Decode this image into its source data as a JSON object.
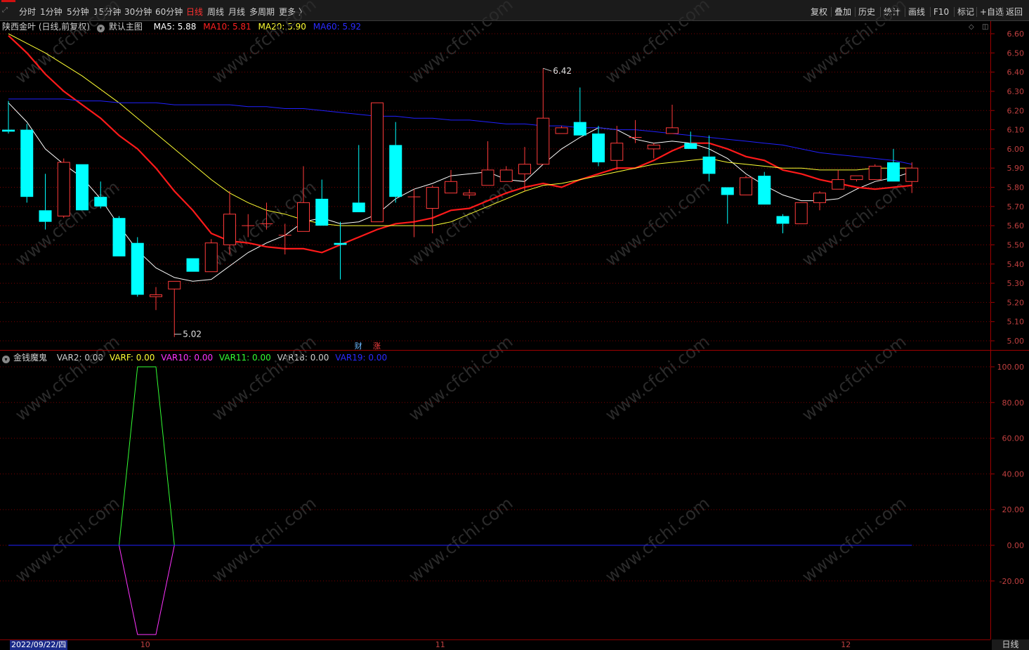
{
  "toolbar": {
    "periods": [
      "分时",
      "1分钟",
      "5分钟",
      "15分钟",
      "30分钟",
      "60分钟",
      "日线",
      "周线",
      "月线",
      "多周期",
      "更多 〉"
    ],
    "active_period": "日线",
    "tools": [
      "复权",
      "叠加",
      "历史",
      "统计",
      "画线",
      "F10",
      "标记",
      "+自选",
      "返回"
    ]
  },
  "main_legend": {
    "stock": "陕西金叶 (日线,前复权)",
    "template": "默认主图",
    "ma5": "MA5: 5.88",
    "ma10": "MA10: 5.81",
    "ma20": "MA20: 5.90",
    "ma60": "MA60: 5.92"
  },
  "sub_legend": {
    "name": "金钱魔鬼",
    "var2": "VAR2: 0.00",
    "varf": "VARF: 0.00",
    "var10": "VAR10: 0.00",
    "var11": "VAR11: 0.00",
    "var18": "VAR18: 0.00",
    "var19": "VAR19: 0.00"
  },
  "markers": {
    "cai": "财",
    "zhang": "涨"
  },
  "annotations": {
    "high": "6.42",
    "low": "5.02"
  },
  "date_axis": {
    "first_date": "2022/09/22/四",
    "month_ticks": [
      "10",
      "11",
      "12"
    ],
    "period_label": "日线"
  },
  "watermark": "www.cfchi.com",
  "colors": {
    "up": "#ff3a3a",
    "down": "#00ffff",
    "ma5": "#ffffff",
    "ma10": "#ff1a1a",
    "ma20": "#ffff33",
    "ma60": "#2020ff",
    "grid": "#7a0000",
    "axis": "#a00000",
    "var_green": "#33ff33",
    "var_magenta": "#ff33ff",
    "zero_line": "#2020ff"
  },
  "chart_data": [
    {
      "type": "candlestick",
      "title": "陕西金叶 (日线,前复权)",
      "ylim": [
        5.0,
        6.6
      ],
      "y_ticks": [
        5.0,
        5.1,
        5.2,
        5.3,
        5.4,
        5.5,
        5.6,
        5.7,
        5.8,
        5.9,
        6.0,
        6.1,
        6.2,
        6.3,
        6.4,
        6.5,
        6.6
      ],
      "candles": [
        {
          "o": 6.1,
          "h": 6.25,
          "l": 6.08,
          "c": 6.09
        },
        {
          "o": 6.1,
          "h": 6.13,
          "l": 5.72,
          "c": 5.75
        },
        {
          "o": 5.68,
          "h": 5.87,
          "l": 5.58,
          "c": 5.62
        },
        {
          "o": 5.65,
          "h": 5.95,
          "l": 5.64,
          "c": 5.93
        },
        {
          "o": 5.92,
          "h": 5.92,
          "l": 5.68,
          "c": 5.68
        },
        {
          "o": 5.75,
          "h": 5.83,
          "l": 5.69,
          "c": 5.7
        },
        {
          "o": 5.64,
          "h": 5.65,
          "l": 5.44,
          "c": 5.44
        },
        {
          "o": 5.51,
          "h": 5.54,
          "l": 5.23,
          "c": 5.24
        },
        {
          "o": 5.23,
          "h": 5.28,
          "l": 5.16,
          "c": 5.24
        },
        {
          "o": 5.27,
          "h": 5.31,
          "l": 5.02,
          "c": 5.31
        },
        {
          "o": 5.43,
          "h": 5.43,
          "l": 5.36,
          "c": 5.36
        },
        {
          "o": 5.36,
          "h": 5.53,
          "l": 5.36,
          "c": 5.51
        },
        {
          "o": 5.5,
          "h": 5.78,
          "l": 5.45,
          "c": 5.66
        },
        {
          "o": 5.6,
          "h": 5.66,
          "l": 5.54,
          "c": 5.6
        },
        {
          "o": 5.61,
          "h": 5.72,
          "l": 5.58,
          "c": 5.61
        },
        {
          "o": 5.55,
          "h": 5.61,
          "l": 5.45,
          "c": 5.55
        },
        {
          "o": 5.57,
          "h": 5.91,
          "l": 5.57,
          "c": 5.72
        },
        {
          "o": 5.74,
          "h": 5.84,
          "l": 5.6,
          "c": 5.6
        },
        {
          "o": 5.51,
          "h": 5.62,
          "l": 5.32,
          "c": 5.5
        },
        {
          "o": 5.72,
          "h": 6.02,
          "l": 5.71,
          "c": 5.67
        },
        {
          "o": 5.62,
          "h": 6.24,
          "l": 5.62,
          "c": 6.24
        },
        {
          "o": 6.02,
          "h": 6.14,
          "l": 5.72,
          "c": 5.75
        },
        {
          "o": 5.75,
          "h": 5.79,
          "l": 5.54,
          "c": 5.75
        },
        {
          "o": 5.69,
          "h": 5.81,
          "l": 5.56,
          "c": 5.8
        },
        {
          "o": 5.77,
          "h": 5.89,
          "l": 5.77,
          "c": 5.83
        },
        {
          "o": 5.76,
          "h": 5.79,
          "l": 5.74,
          "c": 5.77
        },
        {
          "o": 5.81,
          "h": 6.04,
          "l": 5.81,
          "c": 5.89
        },
        {
          "o": 5.83,
          "h": 5.91,
          "l": 5.83,
          "c": 5.89
        },
        {
          "o": 5.87,
          "h": 6.01,
          "l": 5.78,
          "c": 5.92
        },
        {
          "o": 5.92,
          "h": 6.42,
          "l": 5.92,
          "c": 6.16
        },
        {
          "o": 6.08,
          "h": 6.12,
          "l": 6.08,
          "c": 6.11
        },
        {
          "o": 6.14,
          "h": 6.32,
          "l": 6.07,
          "c": 6.07
        },
        {
          "o": 6.08,
          "h": 6.12,
          "l": 5.91,
          "c": 5.93
        },
        {
          "o": 5.94,
          "h": 6.12,
          "l": 5.89,
          "c": 6.03
        },
        {
          "o": 6.06,
          "h": 6.15,
          "l": 6.03,
          "c": 6.06
        },
        {
          "o": 6.0,
          "h": 6.03,
          "l": 5.95,
          "c": 6.02
        },
        {
          "o": 6.08,
          "h": 6.23,
          "l": 6.08,
          "c": 6.11
        },
        {
          "o": 6.03,
          "h": 6.09,
          "l": 6.0,
          "c": 6.0
        },
        {
          "o": 5.96,
          "h": 6.07,
          "l": 5.83,
          "c": 5.87
        },
        {
          "o": 5.8,
          "h": 5.8,
          "l": 5.61,
          "c": 5.76
        },
        {
          "o": 5.76,
          "h": 5.86,
          "l": 5.76,
          "c": 5.85
        },
        {
          "o": 5.86,
          "h": 5.88,
          "l": 5.71,
          "c": 5.71
        },
        {
          "o": 5.65,
          "h": 5.66,
          "l": 5.56,
          "c": 5.61
        },
        {
          "o": 5.61,
          "h": 5.72,
          "l": 5.61,
          "c": 5.72
        },
        {
          "o": 5.72,
          "h": 5.78,
          "l": 5.68,
          "c": 5.77
        },
        {
          "o": 5.79,
          "h": 5.89,
          "l": 5.79,
          "c": 5.84
        },
        {
          "o": 5.84,
          "h": 5.86,
          "l": 5.83,
          "c": 5.86
        },
        {
          "o": 5.84,
          "h": 5.92,
          "l": 5.84,
          "c": 5.91
        },
        {
          "o": 5.93,
          "h": 6.0,
          "l": 5.83,
          "c": 5.83
        },
        {
          "o": 5.83,
          "h": 5.93,
          "l": 5.77,
          "c": 5.9
        }
      ],
      "series": [
        {
          "name": "MA5",
          "values": [
            6.24,
            6.14,
            6.0,
            5.92,
            5.85,
            5.74,
            5.6,
            5.47,
            5.38,
            5.33,
            5.31,
            5.32,
            5.39,
            5.46,
            5.51,
            5.55,
            5.62,
            5.64,
            5.61,
            5.62,
            5.66,
            5.74,
            5.79,
            5.82,
            5.86,
            5.87,
            5.88,
            5.84,
            5.83,
            5.92,
            6.0,
            6.06,
            6.11,
            6.1,
            6.05,
            6.03,
            6.04,
            6.03,
            6.0,
            5.95,
            5.87,
            5.81,
            5.76,
            5.73,
            5.73,
            5.74,
            5.79,
            5.83,
            5.85,
            5.88
          ]
        },
        {
          "name": "MA10",
          "values": [
            6.59,
            6.5,
            6.39,
            6.3,
            6.23,
            6.16,
            6.07,
            6.0,
            5.9,
            5.78,
            5.68,
            5.56,
            5.52,
            5.51,
            5.49,
            5.48,
            5.48,
            5.46,
            5.5,
            5.54,
            5.58,
            5.61,
            5.62,
            5.64,
            5.68,
            5.69,
            5.73,
            5.77,
            5.8,
            5.82,
            5.8,
            5.84,
            5.87,
            5.9,
            5.9,
            5.94,
            5.99,
            6.03,
            6.03,
            6.0,
            5.96,
            5.94,
            5.89,
            5.87,
            5.84,
            5.82,
            5.8,
            5.79,
            5.8,
            5.81
          ]
        },
        {
          "name": "MA20",
          "values": [
            6.6,
            6.55,
            6.5,
            6.44,
            6.38,
            6.31,
            6.24,
            6.16,
            6.08,
            6.0,
            5.92,
            5.84,
            5.77,
            5.72,
            5.68,
            5.66,
            5.63,
            5.61,
            5.6,
            5.6,
            5.6,
            5.6,
            5.6,
            5.6,
            5.62,
            5.66,
            5.7,
            5.74,
            5.78,
            5.81,
            5.82,
            5.84,
            5.86,
            5.88,
            5.9,
            5.92,
            5.93,
            5.94,
            5.95,
            5.93,
            5.92,
            5.91,
            5.9,
            5.9,
            5.89,
            5.89,
            5.89,
            5.9,
            5.9,
            5.9
          ]
        },
        {
          "name": "MA60",
          "values": [
            6.26,
            6.26,
            6.26,
            6.26,
            6.25,
            6.25,
            6.24,
            6.24,
            6.24,
            6.23,
            6.23,
            6.23,
            6.23,
            6.22,
            6.22,
            6.21,
            6.21,
            6.2,
            6.19,
            6.18,
            6.17,
            6.17,
            6.16,
            6.16,
            6.15,
            6.15,
            6.14,
            6.13,
            6.13,
            6.12,
            6.12,
            6.11,
            6.11,
            6.1,
            6.1,
            6.09,
            6.08,
            6.07,
            6.06,
            6.05,
            6.04,
            6.03,
            6.02,
            6.0,
            5.98,
            5.97,
            5.96,
            5.95,
            5.94,
            5.92
          ]
        }
      ]
    },
    {
      "type": "line",
      "title": "金钱魔鬼",
      "ylim": [
        -25,
        100
      ],
      "y_ticks": [
        100.0,
        80.0,
        60.0,
        40.0,
        20.0,
        0.0,
        -20.0
      ],
      "series": [
        {
          "name": "VAR11",
          "points": [
            [
              6,
              0
            ],
            [
              7,
              100
            ],
            [
              8,
              100
            ],
            [
              9,
              0
            ]
          ]
        },
        {
          "name": "VAR10",
          "points": [
            [
              6,
              0
            ],
            [
              7,
              -50
            ],
            [
              8,
              -50
            ],
            [
              9,
              0
            ]
          ]
        },
        {
          "name": "VAR19",
          "points": [
            [
              0,
              0
            ],
            [
              49,
              0
            ]
          ]
        }
      ]
    }
  ]
}
